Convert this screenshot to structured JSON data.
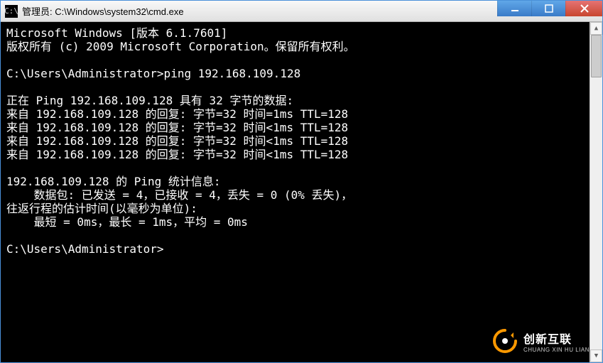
{
  "window": {
    "title": "管理员: C:\\Windows\\system32\\cmd.exe",
    "icon_glyph": "C:\\"
  },
  "terminal": {
    "lines": [
      "Microsoft Windows [版本 6.1.7601]",
      "版权所有 (c) 2009 Microsoft Corporation。保留所有权利。",
      "",
      "C:\\Users\\Administrator>ping 192.168.109.128",
      "",
      "正在 Ping 192.168.109.128 具有 32 字节的数据:",
      "来自 192.168.109.128 的回复: 字节=32 时间=1ms TTL=128",
      "来自 192.168.109.128 的回复: 字节=32 时间<1ms TTL=128",
      "来自 192.168.109.128 的回复: 字节=32 时间<1ms TTL=128",
      "来自 192.168.109.128 的回复: 字节=32 时间<1ms TTL=128",
      "",
      "192.168.109.128 的 Ping 统计信息:",
      "    数据包: 已发送 = 4，已接收 = 4，丢失 = 0 (0% 丢失)，",
      "往返行程的估计时间(以毫秒为单位):",
      "    最短 = 0ms，最长 = 1ms，平均 = 0ms",
      "",
      "C:\\Users\\Administrator>"
    ]
  },
  "watermark": {
    "zh": "创新互联",
    "en": "CHUANG XIN HU LIAN"
  }
}
